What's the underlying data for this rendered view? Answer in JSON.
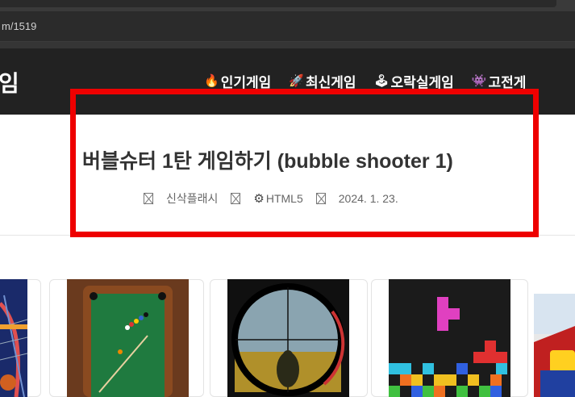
{
  "browser": {
    "url": "m/1519"
  },
  "site": {
    "logo": "임",
    "nav": [
      {
        "icon": "fire-icon",
        "glyph": "🔥",
        "label": "인기게임"
      },
      {
        "icon": "rocket-icon",
        "glyph": "🚀",
        "label": "최신게임"
      },
      {
        "icon": "joystick-icon",
        "glyph": "🕹",
        "label": "오락실게임"
      },
      {
        "icon": "alien-monster-icon",
        "glyph": "👾",
        "label": "고전게"
      }
    ]
  },
  "post": {
    "title": "버블슈터 1탄 게임하기 (bubble shooter 1)",
    "meta": {
      "author": "신삭플래시",
      "category": "HTML5",
      "date": "2024. 1. 23."
    }
  },
  "cards": [
    {
      "name": "card-arcade-basketball",
      "icon": "basketball-game-thumbnail"
    },
    {
      "name": "card-billiards",
      "icon": "billiards-table-thumbnail"
    },
    {
      "name": "card-sniper",
      "icon": "sniper-scope-thumbnail"
    },
    {
      "name": "card-tetris",
      "icon": "falling-blocks-thumbnail"
    },
    {
      "name": "card-racing",
      "icon": "racing-game-thumbnail"
    }
  ],
  "colors": {
    "header_bg": "#222222",
    "highlight": "#ee0000"
  }
}
